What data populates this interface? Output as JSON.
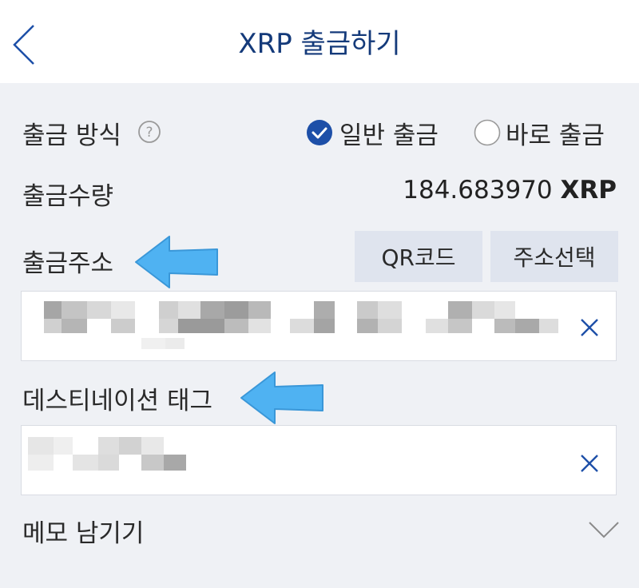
{
  "header": {
    "title": "XRP 출금하기",
    "back_icon": "chevron-left-icon"
  },
  "method": {
    "label": "출금 방식",
    "help_icon": "question-circle-icon",
    "options": [
      {
        "label": "일반 출금",
        "selected": true
      },
      {
        "label": "바로 출금",
        "selected": false
      }
    ],
    "accent": "#1d4fa8"
  },
  "amount": {
    "label": "출금수량",
    "value": "184.683970",
    "unit": "XRP"
  },
  "address": {
    "label": "출금주소",
    "qr_button": "QR코드",
    "select_button": "주소선택",
    "clear_icon": "close-icon"
  },
  "tag": {
    "label": "데스티네이션 태그",
    "clear_icon": "close-icon"
  },
  "memo": {
    "label": "메모 남기기",
    "expand_icon": "chevron-down-icon"
  },
  "annotation": {
    "arrow_color": "#4fb2f2"
  }
}
